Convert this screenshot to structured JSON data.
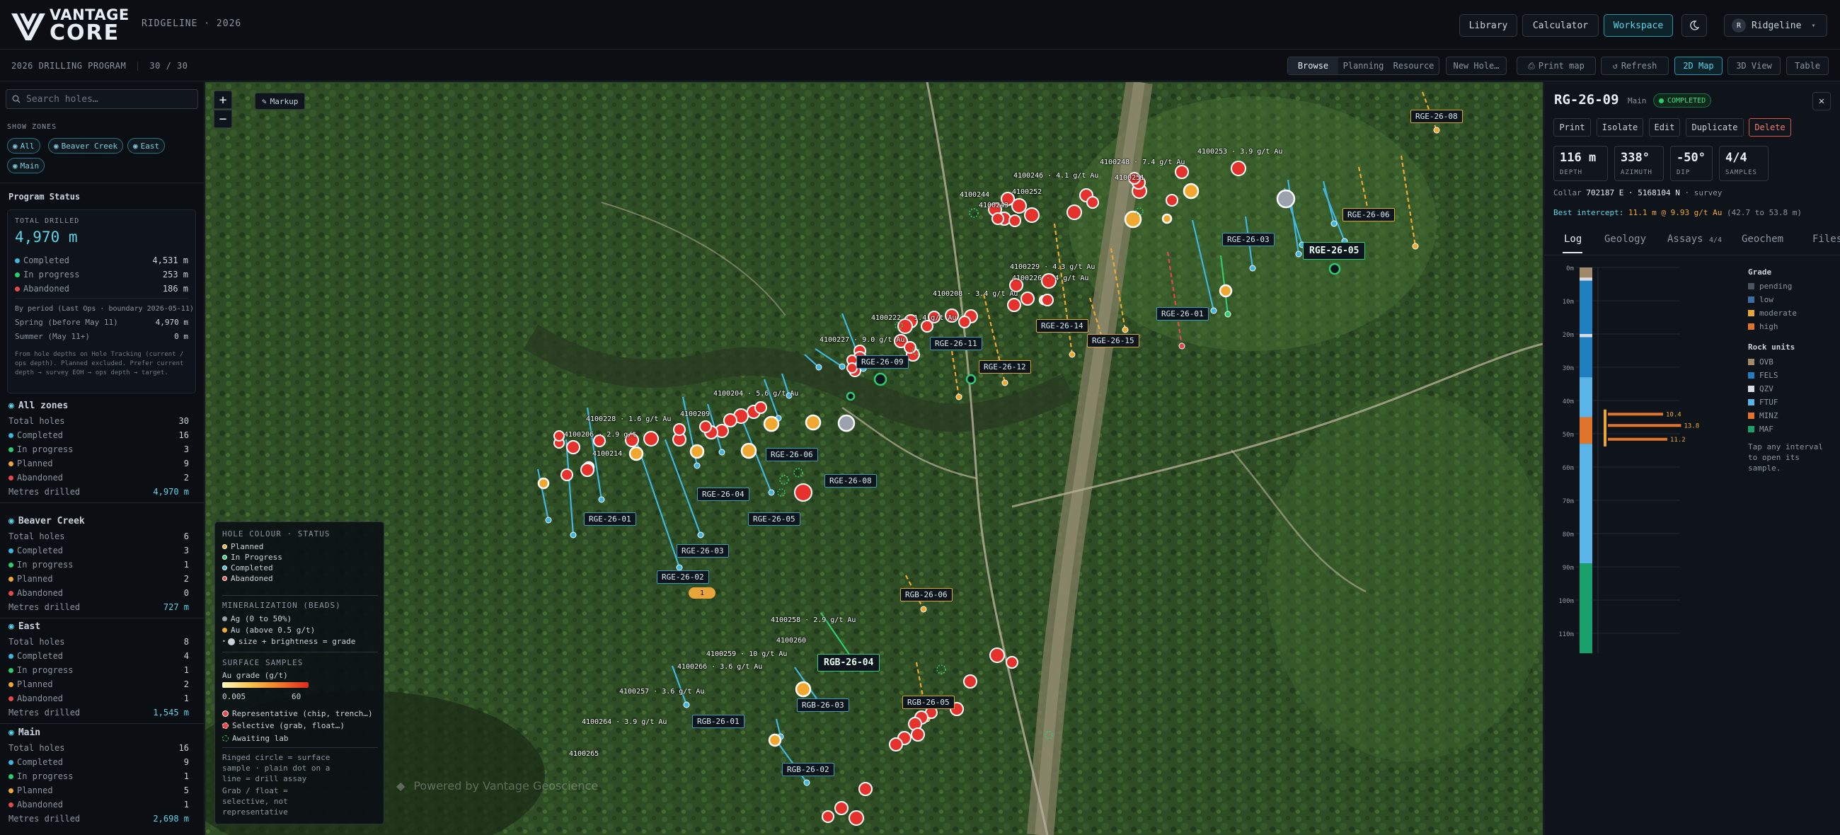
{
  "app": {
    "brand_line1": "VANTAGE",
    "brand_line2": "CORE",
    "subtitle": "RIDGELINE · 2026"
  },
  "header": {
    "nav": [
      "Library",
      "Calculator",
      "Workspace"
    ],
    "active_nav": "Workspace",
    "theme_icon": "moon-icon",
    "user": {
      "initial": "R",
      "name": "Ridgeline"
    }
  },
  "subbar": {
    "program": "2026 DRILLING PROGRAM",
    "count": "30 / 30",
    "modes": [
      "Browse",
      "Planning",
      "Resource"
    ],
    "active_mode": "Browse",
    "new_hole": "New Hole…",
    "print_map": "Print map",
    "refresh": "Refresh",
    "views": [
      "2D Map",
      "3D View",
      "Table"
    ],
    "active_view": "2D Map"
  },
  "sidebar": {
    "search_placeholder": "Search holes…",
    "show_zones_label": "SHOW ZONES",
    "zone_chips": [
      "All",
      "Beaver Creek",
      "East",
      "Main"
    ],
    "status_title": "Program Status",
    "total_label": "TOTAL DRILLED",
    "total_value": "4,970 m",
    "totals": [
      {
        "label": "Completed",
        "value": "4,531 m",
        "color": "#3fb6e0"
      },
      {
        "label": "In progress",
        "value": "253 m",
        "color": "#2ecc71"
      },
      {
        "label": "Abandoned",
        "value": "186 m",
        "color": "#e5484d"
      }
    ],
    "period_label": "By period (Last Ops · boundary 2026-05-11)",
    "periods": [
      {
        "label": "Spring (before May 11)",
        "value": "4,970 m"
      },
      {
        "label": "Summer (May 11+)",
        "value": "0 m"
      }
    ],
    "note": "From hole depths on Hole Tracking (current / ops depth). Planned excluded. Prefer current depth → survey EOH → ops depth → target.",
    "zones": [
      {
        "name": "All zones",
        "rows": [
          [
            "Total holes",
            "30"
          ],
          [
            "Completed",
            "16"
          ],
          [
            "In progress",
            "3"
          ],
          [
            "Planned",
            "9"
          ],
          [
            "Abandoned",
            "2"
          ]
        ],
        "metres": "4,970 m"
      },
      {
        "name": "Beaver Creek",
        "rows": [
          [
            "Total holes",
            "6"
          ],
          [
            "Completed",
            "3"
          ],
          [
            "In progress",
            "1"
          ],
          [
            "Planned",
            "2"
          ],
          [
            "Abandoned",
            "0"
          ]
        ],
        "metres": "727 m"
      },
      {
        "name": "East",
        "rows": [
          [
            "Total holes",
            "8"
          ],
          [
            "Completed",
            "4"
          ],
          [
            "In progress",
            "1"
          ],
          [
            "Planned",
            "2"
          ],
          [
            "Abandoned",
            "1"
          ]
        ],
        "metres": "1,545 m"
      },
      {
        "name": "Main",
        "rows": [
          [
            "Total holes",
            "16"
          ],
          [
            "Completed",
            "9"
          ],
          [
            "In progress",
            "1"
          ],
          [
            "Planned",
            "5"
          ],
          [
            "Abandoned",
            "1"
          ]
        ],
        "metres": "2,698 m"
      }
    ],
    "metres_label": "Metres drilled"
  },
  "map": {
    "markup_btn": "Markup",
    "watermark": "Powered by Vantage Geoscience",
    "hole_labels": [
      {
        "text": "RGE-26-08",
        "type": "pl"
      },
      {
        "text": "RGE-26-06",
        "type": "pl"
      },
      {
        "text": "RGE-26-03",
        "type": "c"
      },
      {
        "text": "RGE-26-05",
        "type": "big"
      },
      {
        "text": "RGE-26-01",
        "type": "c"
      },
      {
        "text": "RGE-26-15",
        "type": "pl"
      },
      {
        "text": "RGE-26-14",
        "type": "pl"
      },
      {
        "text": "RGE-26-12",
        "type": "pl"
      },
      {
        "text": "RGE-26-11",
        "type": "c"
      },
      {
        "text": "RGE-26-09",
        "type": "c"
      },
      {
        "text": "RGE-26-06",
        "type": "c"
      },
      {
        "text": "RGE-26-08",
        "type": "c"
      },
      {
        "text": "RGE-26-04",
        "type": "c"
      },
      {
        "text": "RGE-26-05",
        "type": "c"
      },
      {
        "text": "RGE-26-01",
        "type": "c"
      },
      {
        "text": "RGE-26-03",
        "type": "c"
      },
      {
        "text": "RGE-26-02",
        "type": "c"
      },
      {
        "text": "RGB-26-06",
        "type": "pl"
      },
      {
        "text": "RGB-26-04",
        "type": "big"
      },
      {
        "text": "RGB-26-03",
        "type": "c"
      },
      {
        "text": "RGB-26-05",
        "type": "pl"
      },
      {
        "text": "RGB-26-01",
        "type": "c"
      },
      {
        "text": "RGB-26-02",
        "type": "c"
      }
    ],
    "sample_labels": [
      "4100253 · 3.9 g/t Au",
      "4100248 · 7.4 g/t Au",
      "4100246 · 4.1 g/t Au",
      "4100251",
      "4100252",
      "4100244",
      "4100243",
      "4100229 · 4.3 g/t Au",
      "4100226 · 4 g/t Au",
      "4100208 · 3.4 g/t Au",
      "4100222 · 1.4 g/t Au",
      "4100227 · 9.0 g/t Au",
      "4100204 · 5.6 g/t Au",
      "4100209",
      "4100228 · 1.6 g/t Au",
      "4100206 · 2.9 g/t",
      "4100214",
      "4100258 · 2.9 g/t Au",
      "4100260",
      "4100259 · 10 g/t Au",
      "4100266 · 3.6 g/t Au",
      "4100257 · 3.6 g/t Au",
      "4100264 · 3.9 g/t Au",
      "4100265"
    ],
    "badge_small": "1"
  },
  "legend": {
    "status_title": "HOLE COLOUR · STATUS",
    "statuses": [
      {
        "label": "Planned",
        "color": "#f0a830"
      },
      {
        "label": "In Progress",
        "color": "#2ecc71"
      },
      {
        "label": "Completed",
        "color": "#3fb6e0"
      },
      {
        "label": "Abandoned",
        "color": "#e5484d"
      }
    ],
    "min_title": "MINERALIZATION (BEADS)",
    "min_rows": [
      "Ag (0 to 50%)",
      "Au (above 0.5 g/t)",
      "size + brightness = grade"
    ],
    "surface_title": "SURFACE SAMPLES",
    "grade_label": "Au grade (g/t)",
    "grade_min": "0.005",
    "grade_max": "60",
    "sample_types": [
      "Representative (chip, trench…)",
      "Selective (grab, float…)",
      "Awaiting lab"
    ],
    "note1": "Ringed circle = surface sample · plain dot on a line = drill assay",
    "note2": "Grab / float = selective, not representative"
  },
  "panel": {
    "hole_id": "RG-26-09",
    "zone": "Main",
    "status": "COMPLETED",
    "actions": [
      "Print",
      "Isolate",
      "Edit",
      "Duplicate",
      "Delete"
    ],
    "stats": [
      {
        "value": "116 m",
        "unit": "DEPTH"
      },
      {
        "value": "338°",
        "unit": "AZIMUTH"
      },
      {
        "value": "-50°",
        "unit": "DIP"
      },
      {
        "value": "4/4",
        "unit": "SAMPLES"
      }
    ],
    "collar_label": "Collar",
    "collar_value": "702187 E · 5168104 N",
    "collar_src": "· survey",
    "intercept_label": "Best intercept:",
    "intercept_value": "11.1 m @ 9.93 g/t Au",
    "intercept_range": "(42.7 to 53.8 m)",
    "tabs": [
      "Log",
      "Geology",
      "Assays",
      "Geochem",
      "Files"
    ],
    "assays_count": "4/4",
    "active_tab": "Log",
    "depth_ticks": [
      "0m",
      "10m",
      "20m",
      "30m",
      "40m",
      "50m",
      "60m",
      "70m",
      "80m",
      "90m",
      "100m",
      "110m"
    ],
    "grade_title": "Grade",
    "grades": [
      {
        "label": "pending",
        "color": "#4b5563"
      },
      {
        "label": "low",
        "color": "#3b6ea5"
      },
      {
        "label": "moderate",
        "color": "#e8a53a"
      },
      {
        "label": "high",
        "color": "#e0742a"
      }
    ],
    "rock_title": "Rock units",
    "rocks": [
      {
        "label": "OVB",
        "color": "#a08a6a"
      },
      {
        "label": "FELS",
        "color": "#1f7fc0"
      },
      {
        "label": "QZV",
        "color": "#d7dde3"
      },
      {
        "label": "FTUF",
        "color": "#5ab4e8"
      },
      {
        "label": "MINZ",
        "color": "#e0742a"
      },
      {
        "label": "MAF",
        "color": "#1aa06a"
      }
    ],
    "hint": "Tap any interval to open its sample.",
    "assay_values": [
      "10.4",
      "13.8",
      "11.2"
    ]
  }
}
